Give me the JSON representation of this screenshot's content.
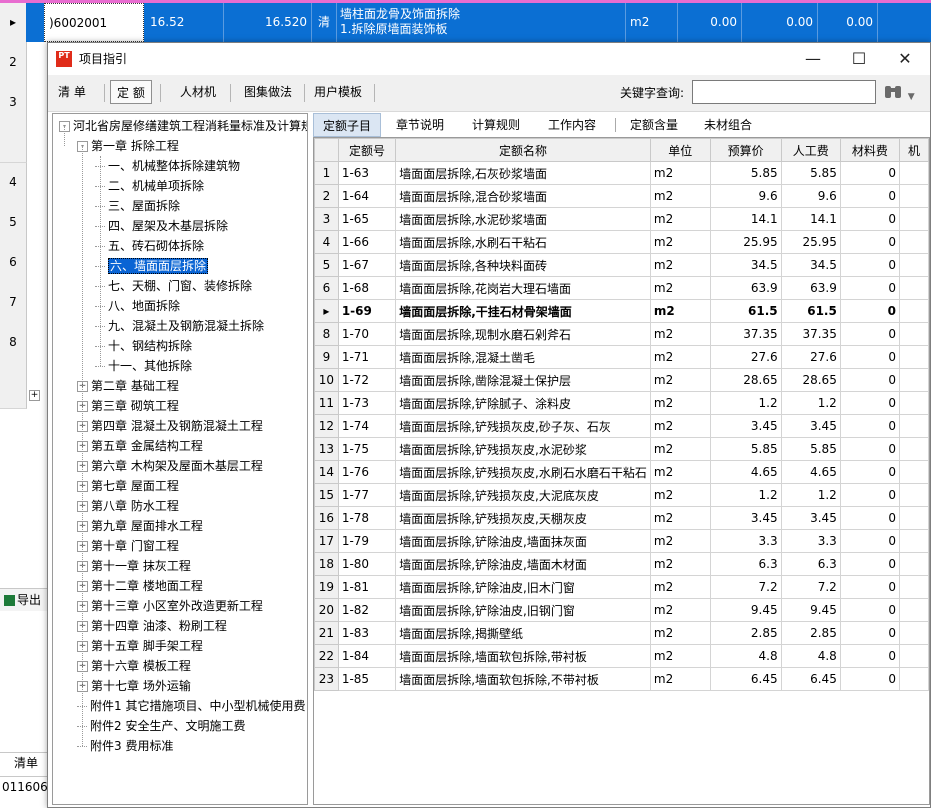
{
  "background": {
    "row_numbers": [
      "2",
      "3",
      "4",
      "5",
      "6",
      "7",
      "8"
    ],
    "selected_row": {
      "code": ")6002001",
      "value1": "16.52",
      "value2": "16.520",
      "type": "清",
      "name_line1": "墙柱面龙骨及饰面拆除",
      "name_line2": "1.拆除原墙面装饰板",
      "unit": "m2",
      "a": "0.00",
      "b": "0.00",
      "c": "0.00"
    },
    "footer_export": "导出",
    "footer_tab": "清单",
    "footer_code": "011606"
  },
  "dialog": {
    "title": "项目指引",
    "logo_text": "PT",
    "toolbar": {
      "buttons": [
        "清 单",
        "定 额",
        "人材机",
        "图集做法",
        "用户模板"
      ],
      "active_index": 1,
      "keyword_label": "关键字查询:",
      "keyword_value": ""
    },
    "tree": {
      "root": "河北省房屋修缮建筑工程消耗量标准及计算规",
      "chapter1": "第一章 拆除工程",
      "sections": [
        "一、机械整体拆除建筑物",
        "二、机械单项拆除",
        "三、屋面拆除",
        "四、屋架及木基层拆除",
        "五、砖石砌体拆除",
        "六、墙面面层拆除",
        "七、天棚、门窗、装修拆除",
        "八、地面拆除",
        "九、混凝土及钢筋混凝土拆除",
        "十、钢结构拆除",
        "十一、其他拆除"
      ],
      "selected_section_index": 5,
      "chapters": [
        "第二章 基础工程",
        "第三章 砌筑工程",
        "第四章 混凝土及钢筋混凝土工程",
        "第五章 金属结构工程",
        "第六章 木构架及屋面木基层工程",
        "第七章 屋面工程",
        "第八章 防水工程",
        "第九章 屋面排水工程",
        "第十章 门窗工程",
        "第十一章 抹灰工程",
        "第十二章 楼地面工程",
        "第十三章 小区室外改造更新工程",
        "第十四章 油漆、粉刷工程",
        "第十五章 脚手架工程",
        "第十六章 模板工程",
        "第十七章 场外运输"
      ],
      "appendices": [
        "附件1 其它措施项目、中小型机械使用费",
        "附件2 安全生产、文明施工费",
        "附件3 费用标准"
      ]
    },
    "tabs": [
      "定额子目",
      "章节说明",
      "计算规则",
      "工作内容",
      "定额含量",
      "未材组合"
    ],
    "active_tab_index": 0,
    "grid": {
      "headers": [
        "定额号",
        "定额名称",
        "单位",
        "预算价",
        "人工费",
        "材料费",
        "机"
      ],
      "current_row_index": 6,
      "rows": [
        {
          "n": "1",
          "code": "1-63",
          "name": "墙面面层拆除,石灰砂浆墙面",
          "unit": "m2",
          "price": "5.85",
          "labor": "5.85",
          "material": "0"
        },
        {
          "n": "2",
          "code": "1-64",
          "name": "墙面面层拆除,混合砂浆墙面",
          "unit": "m2",
          "price": "9.6",
          "labor": "9.6",
          "material": "0"
        },
        {
          "n": "3",
          "code": "1-65",
          "name": "墙面面层拆除,水泥砂浆墙面",
          "unit": "m2",
          "price": "14.1",
          "labor": "14.1",
          "material": "0"
        },
        {
          "n": "4",
          "code": "1-66",
          "name": "墙面面层拆除,水刷石干粘石",
          "unit": "m2",
          "price": "25.95",
          "labor": "25.95",
          "material": "0"
        },
        {
          "n": "5",
          "code": "1-67",
          "name": "墙面面层拆除,各种块料面砖",
          "unit": "m2",
          "price": "34.5",
          "labor": "34.5",
          "material": "0"
        },
        {
          "n": "6",
          "code": "1-68",
          "name": "墙面面层拆除,花岗岩大理石墙面",
          "unit": "m2",
          "price": "63.9",
          "labor": "63.9",
          "material": "0"
        },
        {
          "n": "",
          "code": "1-69",
          "name": "墙面面层拆除,干挂石材骨架墙面",
          "unit": "m2",
          "price": "61.5",
          "labor": "61.5",
          "material": "0"
        },
        {
          "n": "8",
          "code": "1-70",
          "name": "墙面面层拆除,现制水磨石剁斧石",
          "unit": "m2",
          "price": "37.35",
          "labor": "37.35",
          "material": "0"
        },
        {
          "n": "9",
          "code": "1-71",
          "name": "墙面面层拆除,混凝土凿毛",
          "unit": "m2",
          "price": "27.6",
          "labor": "27.6",
          "material": "0"
        },
        {
          "n": "10",
          "code": "1-72",
          "name": "墙面面层拆除,凿除混凝土保护层",
          "unit": "m2",
          "price": "28.65",
          "labor": "28.65",
          "material": "0"
        },
        {
          "n": "11",
          "code": "1-73",
          "name": "墙面面层拆除,铲除腻子、涂料皮",
          "unit": "m2",
          "price": "1.2",
          "labor": "1.2",
          "material": "0"
        },
        {
          "n": "12",
          "code": "1-74",
          "name": "墙面面层拆除,铲残损灰皮,砂子灰、石灰",
          "unit": "m2",
          "price": "3.45",
          "labor": "3.45",
          "material": "0"
        },
        {
          "n": "13",
          "code": "1-75",
          "name": "墙面面层拆除,铲残损灰皮,水泥砂浆",
          "unit": "m2",
          "price": "5.85",
          "labor": "5.85",
          "material": "0"
        },
        {
          "n": "14",
          "code": "1-76",
          "name": "墙面面层拆除,铲残损灰皮,水刷石水磨石干粘石",
          "unit": "m2",
          "price": "4.65",
          "labor": "4.65",
          "material": "0"
        },
        {
          "n": "15",
          "code": "1-77",
          "name": "墙面面层拆除,铲残损灰皮,大泥底灰皮",
          "unit": "m2",
          "price": "1.2",
          "labor": "1.2",
          "material": "0"
        },
        {
          "n": "16",
          "code": "1-78",
          "name": "墙面面层拆除,铲残损灰皮,天棚灰皮",
          "unit": "m2",
          "price": "3.45",
          "labor": "3.45",
          "material": "0"
        },
        {
          "n": "17",
          "code": "1-79",
          "name": "墙面面层拆除,铲除油皮,墙面抹灰面",
          "unit": "m2",
          "price": "3.3",
          "labor": "3.3",
          "material": "0"
        },
        {
          "n": "18",
          "code": "1-80",
          "name": "墙面面层拆除,铲除油皮,墙面木材面",
          "unit": "m2",
          "price": "6.3",
          "labor": "6.3",
          "material": "0"
        },
        {
          "n": "19",
          "code": "1-81",
          "name": "墙面面层拆除,铲除油皮,旧木门窗",
          "unit": "m2",
          "price": "7.2",
          "labor": "7.2",
          "material": "0"
        },
        {
          "n": "20",
          "code": "1-82",
          "name": "墙面面层拆除,铲除油皮,旧钢门窗",
          "unit": "m2",
          "price": "9.45",
          "labor": "9.45",
          "material": "0"
        },
        {
          "n": "21",
          "code": "1-83",
          "name": "墙面面层拆除,揭撕壁纸",
          "unit": "m2",
          "price": "2.85",
          "labor": "2.85",
          "material": "0"
        },
        {
          "n": "22",
          "code": "1-84",
          "name": "墙面面层拆除,墙面软包拆除,带衬板",
          "unit": "m2",
          "price": "4.8",
          "labor": "4.8",
          "material": "0"
        },
        {
          "n": "23",
          "code": "1-85",
          "name": "墙面面层拆除,墙面软包拆除,不带衬板",
          "unit": "m2",
          "price": "6.45",
          "labor": "6.45",
          "material": "0"
        }
      ]
    }
  }
}
